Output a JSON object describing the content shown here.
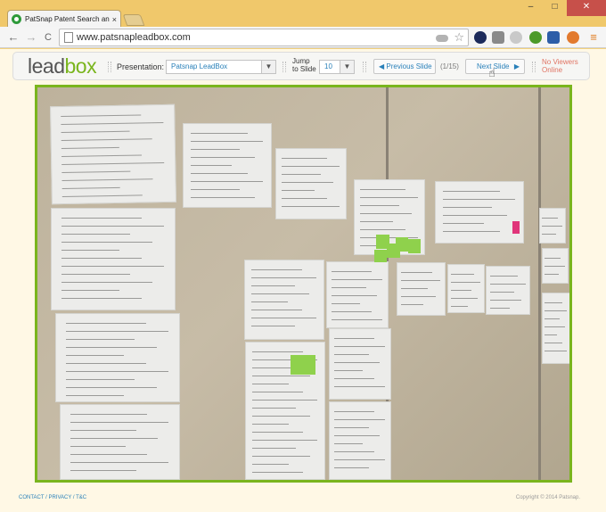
{
  "browser": {
    "tab_title": "PatSnap Patent Search and",
    "tab_close": "×",
    "url": "www.patsnapleadbox.com",
    "window_buttons": {
      "minimize": "–",
      "maximize": "□",
      "close": "✕"
    },
    "nav": {
      "back": "←",
      "forward": "→",
      "reload": "C"
    },
    "star": "☆",
    "menu": "≡"
  },
  "leadbox": {
    "logo_lead": "lead",
    "logo_box": "box",
    "presentation_label": "Presentation:",
    "presentation_value": "Patsnap LeadBox",
    "jump_label_1": "Jump",
    "jump_label_2": "to Slide",
    "jump_value": "10",
    "prev_label": "Previous Slide",
    "prev_arrow": "◀",
    "counter": "(1/15)",
    "next_label": "Next Slide",
    "next_arrow": "▶",
    "viewers_1": "No Viewers",
    "viewers_2": "Online",
    "dropdown_arrow": "▼"
  },
  "footer": {
    "links": "CONTACT / PRIVACY / T&C",
    "copyright": "Copyright © 2014 Patsnap."
  },
  "colors": {
    "accent_green": "#7ab51d",
    "link_blue": "#2980b9",
    "viewers_red": "#e07463",
    "titlebar": "#f0c86b"
  }
}
